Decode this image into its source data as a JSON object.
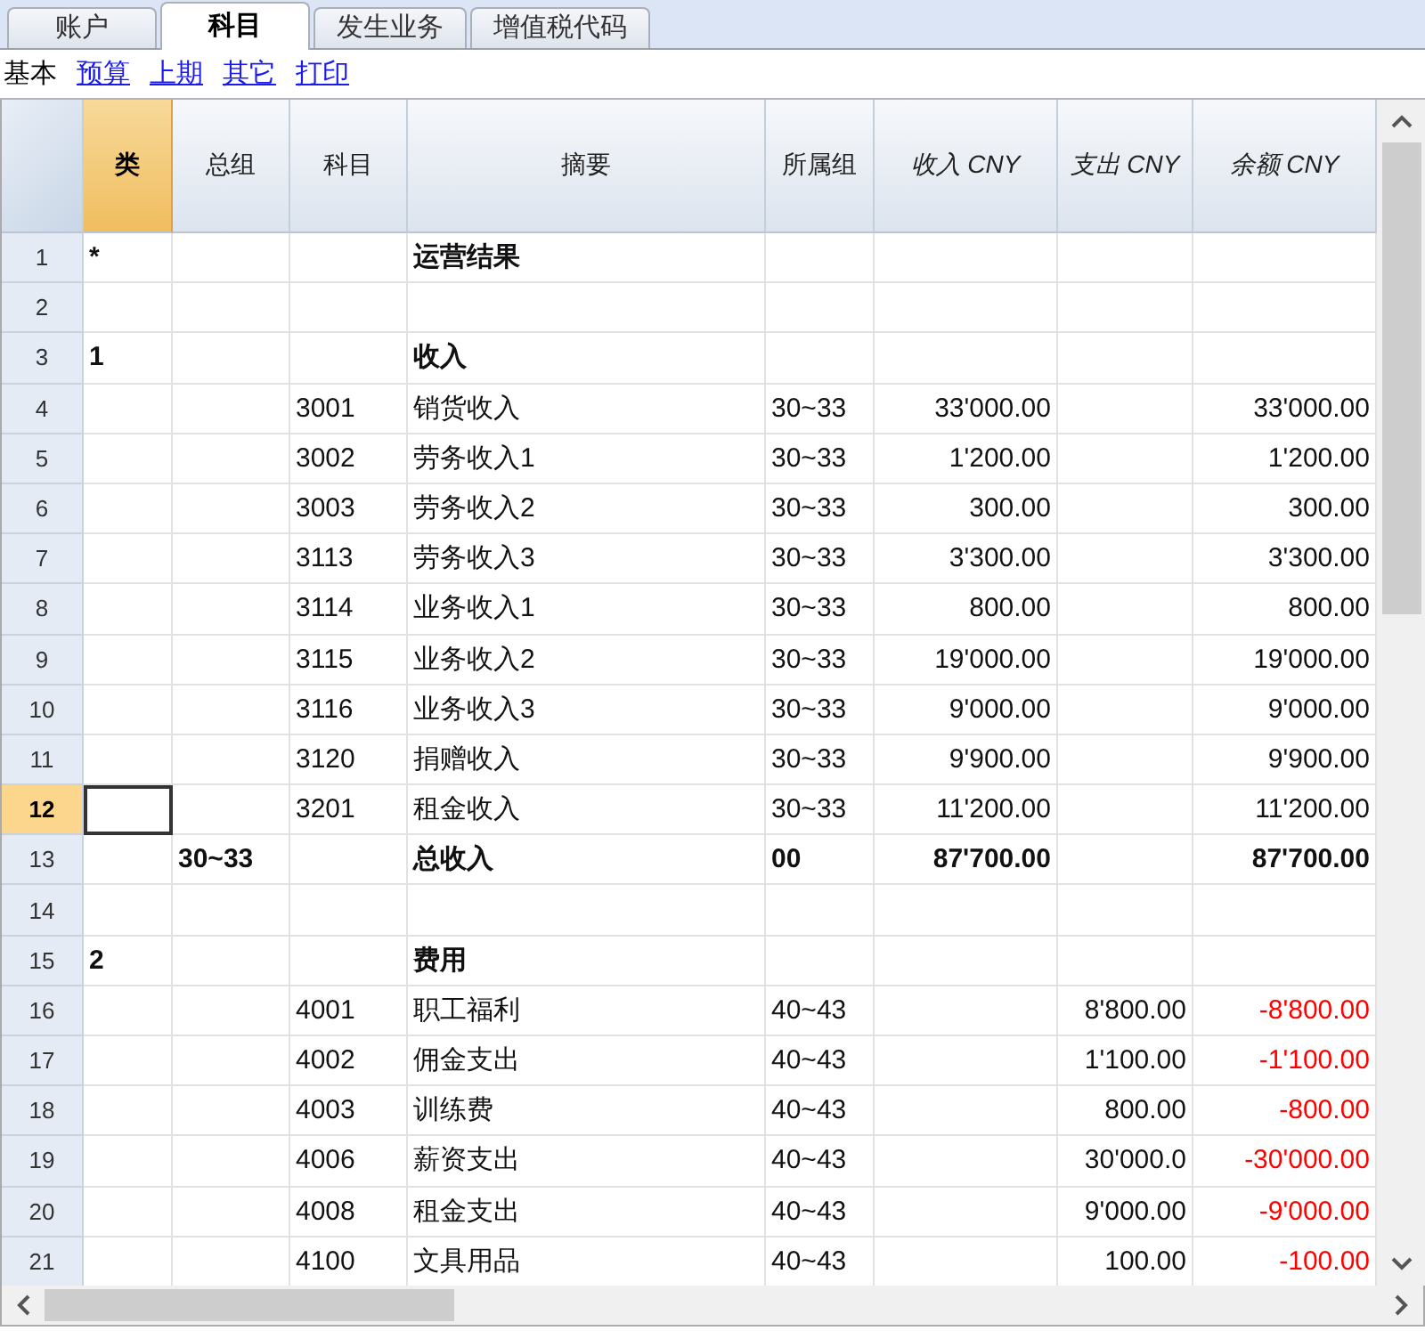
{
  "tabs": [
    {
      "label": "账户",
      "selected": false
    },
    {
      "label": "科目",
      "selected": true
    },
    {
      "label": "发生业务",
      "selected": false
    },
    {
      "label": "增值税代码",
      "selected": false
    }
  ],
  "views": [
    {
      "label": "基本",
      "selected": true
    },
    {
      "label": "预算",
      "selected": false
    },
    {
      "label": "上期",
      "selected": false
    },
    {
      "label": "其它",
      "selected": false
    },
    {
      "label": "打印",
      "selected": false
    }
  ],
  "table": {
    "columns": [
      {
        "label": "类",
        "kind": "text",
        "selected": true
      },
      {
        "label": "总组",
        "kind": "text",
        "selected": false
      },
      {
        "label": "科目",
        "kind": "text",
        "selected": false
      },
      {
        "label": "摘要",
        "kind": "text",
        "selected": false
      },
      {
        "label": "所属组",
        "kind": "text",
        "selected": false
      },
      {
        "label": "收入 CNY",
        "kind": "amount",
        "selected": false
      },
      {
        "label": "支出 CNY",
        "kind": "amount",
        "selected": false
      },
      {
        "label": "余额 CNY",
        "kind": "amount",
        "selected": false
      }
    ],
    "rows": [
      {
        "num": "1",
        "kind": "heading",
        "selected": false,
        "cells": [
          "*",
          "",
          "",
          "运营结果",
          "",
          "",
          "",
          ""
        ]
      },
      {
        "num": "2",
        "kind": "item",
        "selected": false,
        "cells": [
          "",
          "",
          "",
          "",
          "",
          "",
          "",
          ""
        ]
      },
      {
        "num": "3",
        "kind": "heading",
        "selected": false,
        "cells": [
          "1",
          "",
          "",
          "收入",
          "",
          "",
          "",
          ""
        ]
      },
      {
        "num": "4",
        "kind": "item",
        "selected": false,
        "negative": false,
        "cells": [
          "",
          "",
          "3001",
          "销货收入",
          "30~33",
          "33'000.00",
          "",
          "33'000.00"
        ]
      },
      {
        "num": "5",
        "kind": "item",
        "selected": false,
        "negative": false,
        "cells": [
          "",
          "",
          "3002",
          "劳务收入1",
          "30~33",
          "1'200.00",
          "",
          "1'200.00"
        ]
      },
      {
        "num": "6",
        "kind": "item",
        "selected": false,
        "negative": false,
        "cells": [
          "",
          "",
          "3003",
          "劳务收入2",
          "30~33",
          "300.00",
          "",
          "300.00"
        ]
      },
      {
        "num": "7",
        "kind": "item",
        "selected": false,
        "negative": false,
        "cells": [
          "",
          "",
          "3113",
          "劳务收入3",
          "30~33",
          "3'300.00",
          "",
          "3'300.00"
        ]
      },
      {
        "num": "8",
        "kind": "item",
        "selected": false,
        "negative": false,
        "cells": [
          "",
          "",
          "3114",
          "业务收入1",
          "30~33",
          "800.00",
          "",
          "800.00"
        ]
      },
      {
        "num": "9",
        "kind": "item",
        "selected": false,
        "negative": false,
        "cells": [
          "",
          "",
          "3115",
          "业务收入2",
          "30~33",
          "19'000.00",
          "",
          "19'000.00"
        ]
      },
      {
        "num": "10",
        "kind": "item",
        "selected": false,
        "negative": false,
        "cells": [
          "",
          "",
          "3116",
          "业务收入3",
          "30~33",
          "9'000.00",
          "",
          "9'000.00"
        ]
      },
      {
        "num": "11",
        "kind": "item",
        "selected": false,
        "negative": false,
        "cells": [
          "",
          "",
          "3120",
          "捐赠收入",
          "30~33",
          "9'900.00",
          "",
          "9'900.00"
        ]
      },
      {
        "num": "12",
        "kind": "item",
        "selected": true,
        "negative": false,
        "cells": [
          "",
          "",
          "3201",
          "租金收入",
          "30~33",
          "11'200.00",
          "",
          "11'200.00"
        ]
      },
      {
        "num": "13",
        "kind": "total",
        "selected": false,
        "negative": false,
        "cells": [
          "",
          "30~33",
          "",
          "总收入",
          "00",
          "87'700.00",
          "",
          "87'700.00"
        ]
      },
      {
        "num": "14",
        "kind": "item",
        "selected": false,
        "cells": [
          "",
          "",
          "",
          "",
          "",
          "",
          "",
          ""
        ]
      },
      {
        "num": "15",
        "kind": "heading",
        "selected": false,
        "cells": [
          "2",
          "",
          "",
          "费用",
          "",
          "",
          "",
          ""
        ]
      },
      {
        "num": "16",
        "kind": "item",
        "selected": false,
        "negative": true,
        "cells": [
          "",
          "",
          "4001",
          "职工福利",
          "40~43",
          "",
          "8'800.00",
          "-8'800.00"
        ]
      },
      {
        "num": "17",
        "kind": "item",
        "selected": false,
        "negative": true,
        "cells": [
          "",
          "",
          "4002",
          "佣金支出",
          "40~43",
          "",
          "1'100.00",
          "-1'100.00"
        ]
      },
      {
        "num": "18",
        "kind": "item",
        "selected": false,
        "negative": true,
        "cells": [
          "",
          "",
          "4003",
          "训练费",
          "40~43",
          "",
          "800.00",
          "-800.00"
        ]
      },
      {
        "num": "19",
        "kind": "item",
        "selected": false,
        "negative": true,
        "cells": [
          "",
          "",
          "4006",
          "薪资支出",
          "40~43",
          "",
          "30'000.0",
          "-30'000.00"
        ]
      },
      {
        "num": "20",
        "kind": "item",
        "selected": false,
        "negative": true,
        "cells": [
          "",
          "",
          "4008",
          "租金支出",
          "40~43",
          "",
          "9'000.00",
          "-9'000.00"
        ]
      },
      {
        "num": "21",
        "kind": "item",
        "selected": false,
        "negative": true,
        "cells": [
          "",
          "",
          "4100",
          "文具用品",
          "40~43",
          "",
          "100.00",
          "-100.00"
        ]
      }
    ]
  }
}
